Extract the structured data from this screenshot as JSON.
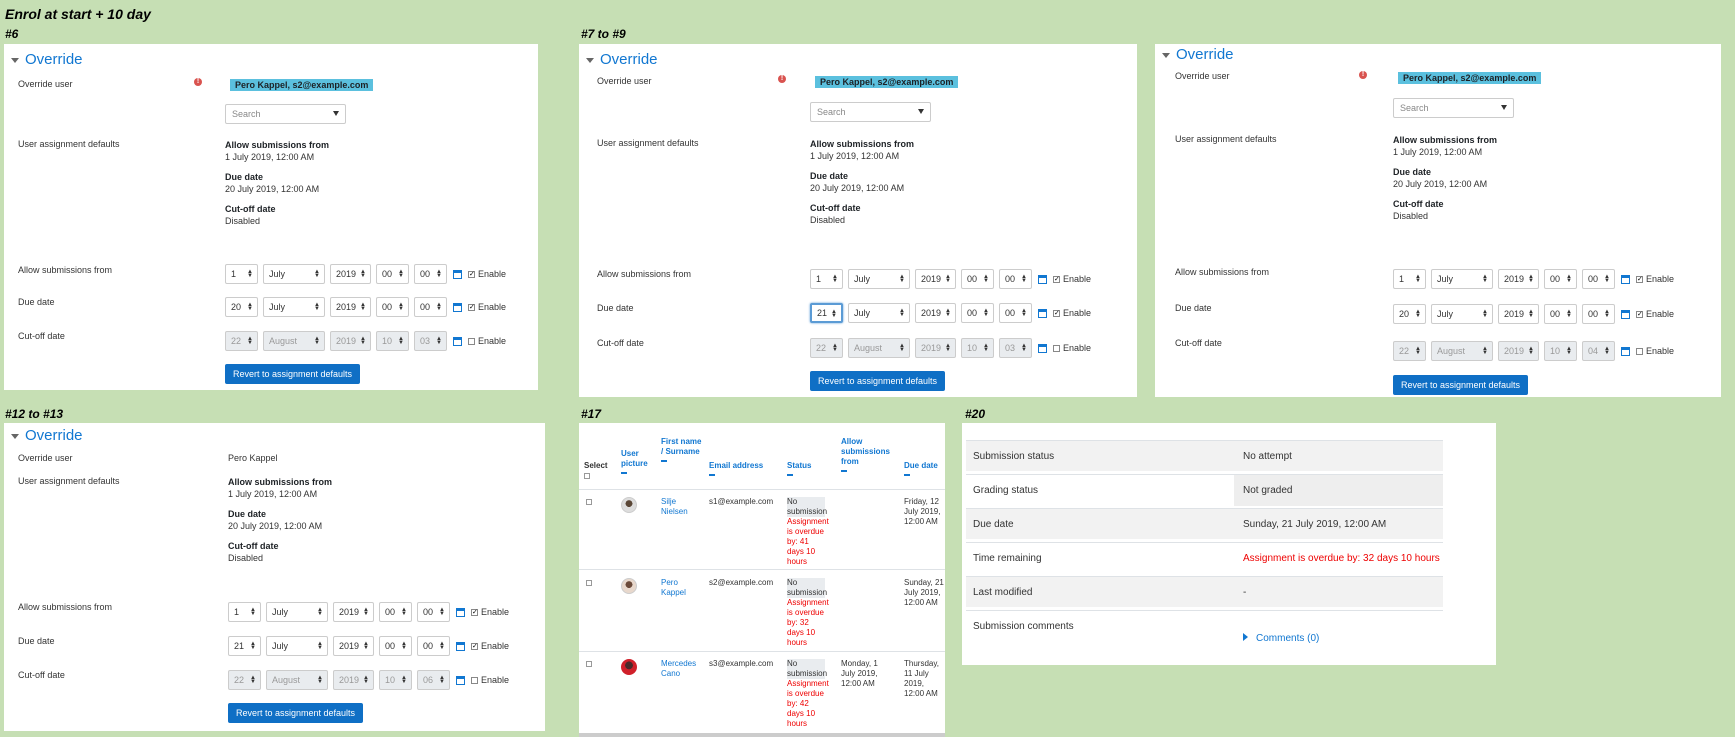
{
  "page_title": "Enrol at start + 10 day",
  "sections": {
    "s6": "#6",
    "s7to9": "#7 to #9",
    "s12to13": "#12 to #13",
    "s17": "#17",
    "s20": "#20"
  },
  "override_form": {
    "title": "Override",
    "labels": {
      "override_user": "Override user",
      "user_assignment_defaults": "User assignment defaults",
      "allow_submissions_from": "Allow submissions from",
      "due_date": "Due date",
      "cutoff_date": "Cut-off date"
    },
    "selected_user_badge": "Pero Kappel, s2@example.com",
    "selected_user_plain": "Pero Kappel",
    "search_placeholder": "Search",
    "error_icon": "!",
    "defaults": {
      "allow_from_label": "Allow submissions from",
      "allow_from_value": "1 July 2019, 12:00 AM",
      "due_label": "Due date",
      "due_value": "20 July 2019, 12:00 AM",
      "cutoff_label": "Cut-off date",
      "cutoff_value": "Disabled"
    },
    "enable_label": "Enable",
    "revert_button": "Revert to assignment defaults",
    "month_july": "July",
    "month_august": "August",
    "year": "2019",
    "zero": "00",
    "allow_day": "1",
    "cut_day": "22",
    "cut_hour": "10",
    "due_day_a": "20",
    "due_day_b": "21",
    "cut_min_a": "03",
    "cut_min_b": "04",
    "cut_min_c": "06"
  },
  "participants": {
    "headers": {
      "select": "Select",
      "user_picture": "User picture",
      "first_surname": "First name / Surname",
      "email": "Email address",
      "status": "Status",
      "allow_from": "Allow submissions from",
      "due_date": "Due date"
    },
    "rows": [
      {
        "name": "Silje Nielsen",
        "email": "s1@example.com",
        "status_ns": "No submission",
        "status_od": "Assignment is overdue by: 41 days 10 hours",
        "allow_from": "",
        "due_date": "Friday, 12 July 2019, 12:00 AM"
      },
      {
        "name": "Pero Kappel",
        "email": "s2@example.com",
        "status_ns": "No submission",
        "status_od": "Assignment is overdue by: 32 days 10 hours",
        "allow_from": "",
        "due_date": "Sunday, 21 July 2019, 12:00 AM"
      },
      {
        "name": "Mercedes Cano",
        "email": "s3@example.com",
        "status_ns": "No submission",
        "status_od": "Assignment is overdue by: 42 days 10 hours",
        "allow_from": "Monday, 1 July 2019, 12:00 AM",
        "due_date": "Thursday, 11 July 2019, 12:00 AM"
      }
    ]
  },
  "submission_status": {
    "rows": [
      {
        "label": "Submission status",
        "value": "No attempt"
      },
      {
        "label": "Grading status",
        "value": "Not graded"
      },
      {
        "label": "Due date",
        "value": "Sunday, 21 July 2019, 12:00 AM"
      },
      {
        "label": "Time remaining",
        "value": "Assignment is overdue by: 32 days 10 hours"
      },
      {
        "label": "Last modified",
        "value": "-"
      },
      {
        "label": "Submission comments",
        "value": "Comments (0)"
      }
    ]
  },
  "colors": {
    "background": "#c6dfb4",
    "link": "#1177d1",
    "button": "#0f6fc5",
    "badge": "#5bc0de",
    "overdue": "#e00000"
  }
}
